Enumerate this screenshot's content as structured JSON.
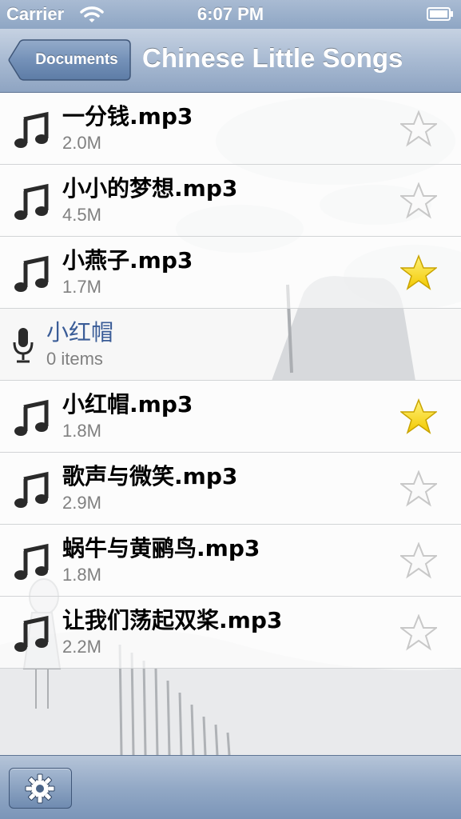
{
  "status_bar": {
    "carrier": "Carrier",
    "time": "6:07 PM"
  },
  "nav": {
    "back_label": "Documents",
    "title": "Chinese Little Songs"
  },
  "list": {
    "items": [
      {
        "type": "file",
        "name": "一分钱.mp3",
        "size": "2.0M",
        "icon": "music-note-icon",
        "starred": false
      },
      {
        "type": "file",
        "name": "小小的梦想.mp3",
        "size": "4.5M",
        "icon": "music-note-icon",
        "starred": false
      },
      {
        "type": "file",
        "name": "小燕子.mp3",
        "size": "1.7M",
        "icon": "music-note-icon",
        "starred": true
      },
      {
        "type": "folder",
        "name": "小红帽",
        "count": "0 items",
        "icon": "microphone-icon"
      },
      {
        "type": "file",
        "name": "小红帽.mp3",
        "size": "1.8M",
        "icon": "music-note-icon",
        "starred": true
      },
      {
        "type": "file",
        "name": "歌声与微笑.mp3",
        "size": "2.9M",
        "icon": "music-note-icon",
        "starred": false
      },
      {
        "type": "file",
        "name": "蜗牛与黄鹂鸟.mp3",
        "size": "1.8M",
        "icon": "music-note-icon",
        "starred": false
      },
      {
        "type": "file",
        "name": "让我们荡起双桨.mp3",
        "size": "2.2M",
        "icon": "music-note-icon",
        "starred": false
      }
    ]
  },
  "toolbar": {
    "settings_icon": "gear-icon"
  },
  "colors": {
    "bar_blue": "#8ea6c4",
    "folder_name": "#3a5c97",
    "star_gold": "#f5d300",
    "secondary_text": "#808080"
  }
}
